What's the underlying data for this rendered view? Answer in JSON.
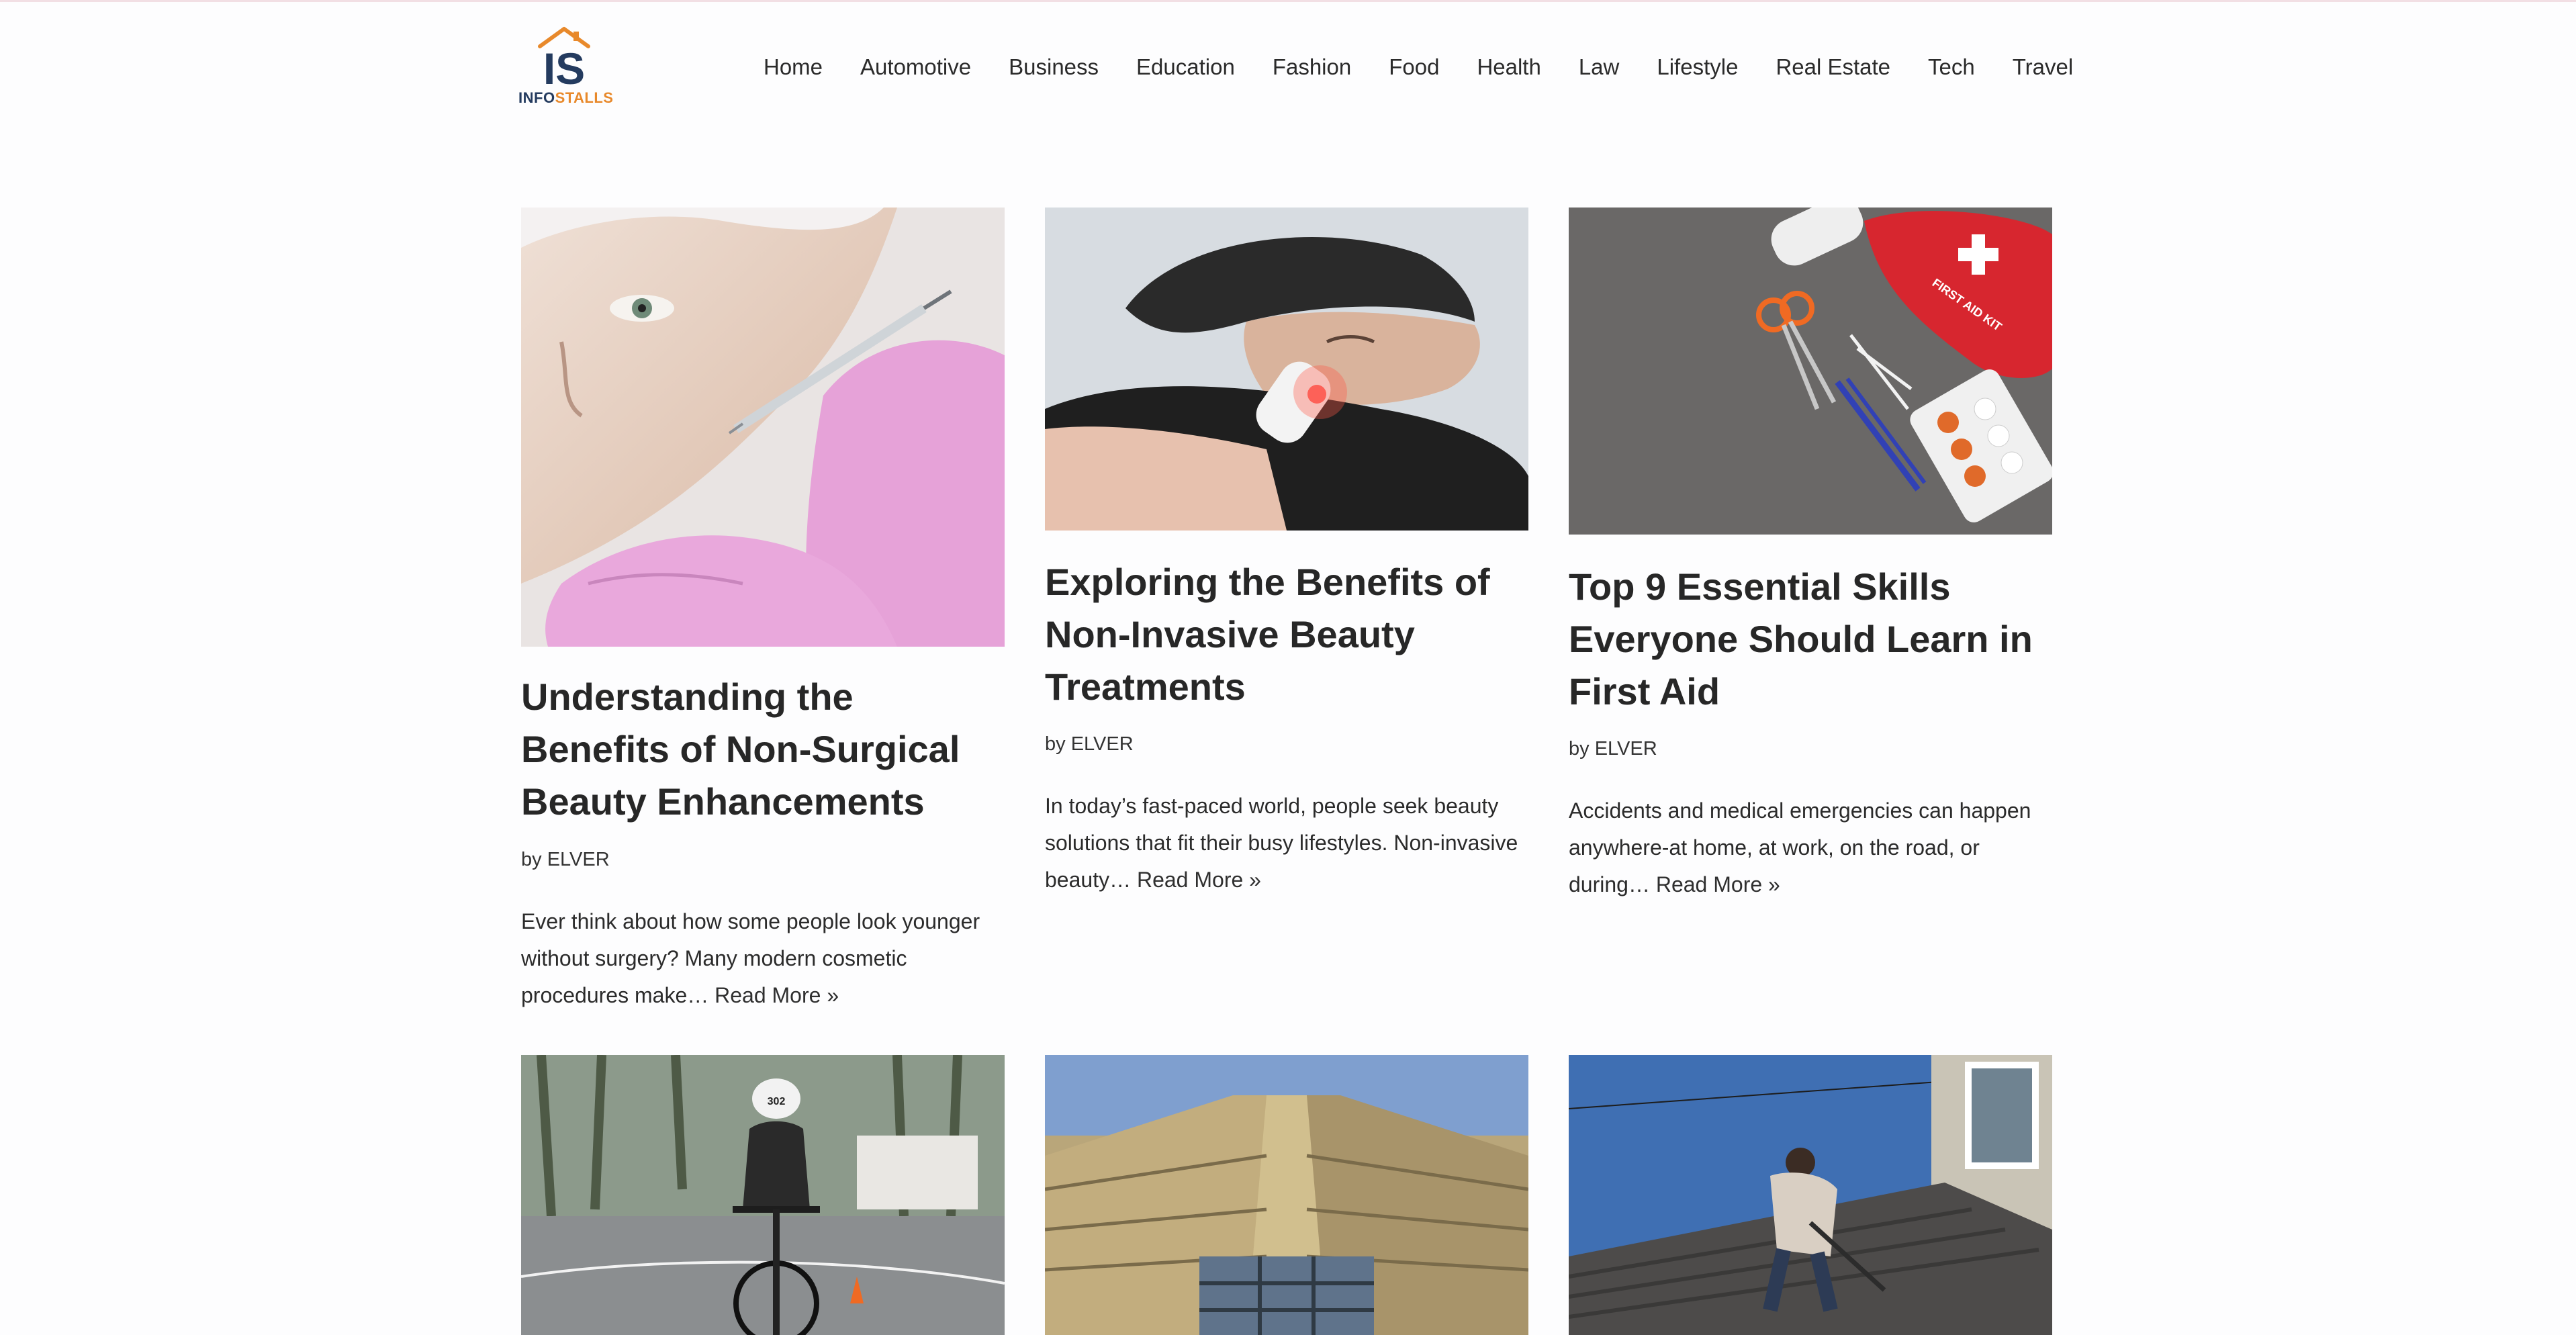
{
  "site": {
    "logo_mark": "IS",
    "logo_info": "INFO",
    "logo_stalls": "STALLS"
  },
  "nav": {
    "items": [
      "Home",
      "Automotive",
      "Business",
      "Education",
      "Fashion",
      "Food",
      "Health",
      "Law",
      "Lifestyle",
      "Real Estate",
      "Tech",
      "Travel"
    ]
  },
  "colors": {
    "background": "#fdfdfe",
    "logo_blue": "#243b5f",
    "logo_orange": "#e8892b",
    "text": "#272727"
  },
  "posts": [
    {
      "title": "Understanding the Benefits of Non-Surgical Beauty Enhancements",
      "by": "by",
      "author": "ELVER",
      "excerpt": "Ever think about how some people look younger without surgery? Many modern cosmetic procedures make…",
      "read_more": "Read More »",
      "image": "cosmetic-injection-photo"
    },
    {
      "title": "Exploring the Benefits of Non-Invasive Beauty Treatments",
      "by": "by",
      "author": "ELVER",
      "excerpt": "In today’s fast-paced world, people seek beauty solutions that fit their busy lifestyles. Non-invasive beauty…",
      "read_more": "Read More »",
      "image": "facial-device-treatment-photo"
    },
    {
      "title": "Top 9 Essential Skills Everyone Should Learn in First Aid",
      "by": "by",
      "author": "ELVER",
      "excerpt": "Accidents and medical emergencies can happen anywhere-at home, at work, on the road, or during…",
      "read_more": "Read More »",
      "image": "first-aid-kit-photo",
      "kit_label": "FIRST AID KIT"
    },
    {
      "image": "cyclist-race-photo",
      "bib_number": "302"
    },
    {
      "image": "building-facade-photo"
    },
    {
      "image": "roof-repair-worker-photo"
    }
  ]
}
